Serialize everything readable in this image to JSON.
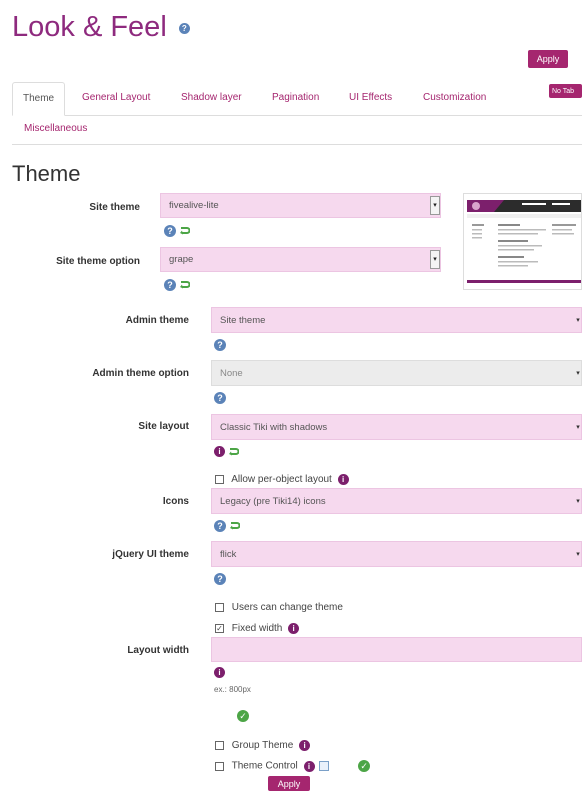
{
  "page": {
    "title": "Look & Feel",
    "apply_top": "Apply",
    "no_tabs": "No Tab",
    "apply_bottom": "Apply"
  },
  "tabs": [
    {
      "label": "Theme",
      "active": true
    },
    {
      "label": "General Layout"
    },
    {
      "label": "Shadow layer"
    },
    {
      "label": "Pagination"
    },
    {
      "label": "UI Effects"
    },
    {
      "label": "Customization"
    },
    {
      "label": "Miscellaneous"
    }
  ],
  "section": {
    "title": "Theme"
  },
  "fields": {
    "site_theme": {
      "label": "Site theme",
      "value": "fivealive-lite"
    },
    "site_theme_option": {
      "label": "Site theme option",
      "value": "grape"
    },
    "admin_theme": {
      "label": "Admin theme",
      "value": "Site theme"
    },
    "admin_theme_option": {
      "label": "Admin theme option",
      "value": "None"
    },
    "site_layout": {
      "label": "Site layout",
      "value": "Classic Tiki with shadows"
    },
    "allow_per_object": {
      "label": "Allow per-object layout",
      "checked": false
    },
    "icons": {
      "label": "Icons",
      "value": "Legacy (pre Tiki14) icons"
    },
    "jquery_ui_theme": {
      "label": "jQuery UI theme",
      "value": "flick"
    },
    "users_change_theme": {
      "label": "Users can change theme",
      "checked": false
    },
    "fixed_width": {
      "label": "Fixed width",
      "checked": true
    },
    "layout_width": {
      "label": "Layout width",
      "value": "",
      "hint": "ex.: 800px"
    },
    "group_theme": {
      "label": "Group Theme",
      "checked": false
    },
    "theme_control": {
      "label": "Theme Control",
      "checked": false
    }
  },
  "colors": {
    "accent": "#a5266f",
    "title": "#8e2a7e",
    "field_bg": "#f6d9ee",
    "help": "#5b83b8",
    "ok": "#4ca546"
  }
}
